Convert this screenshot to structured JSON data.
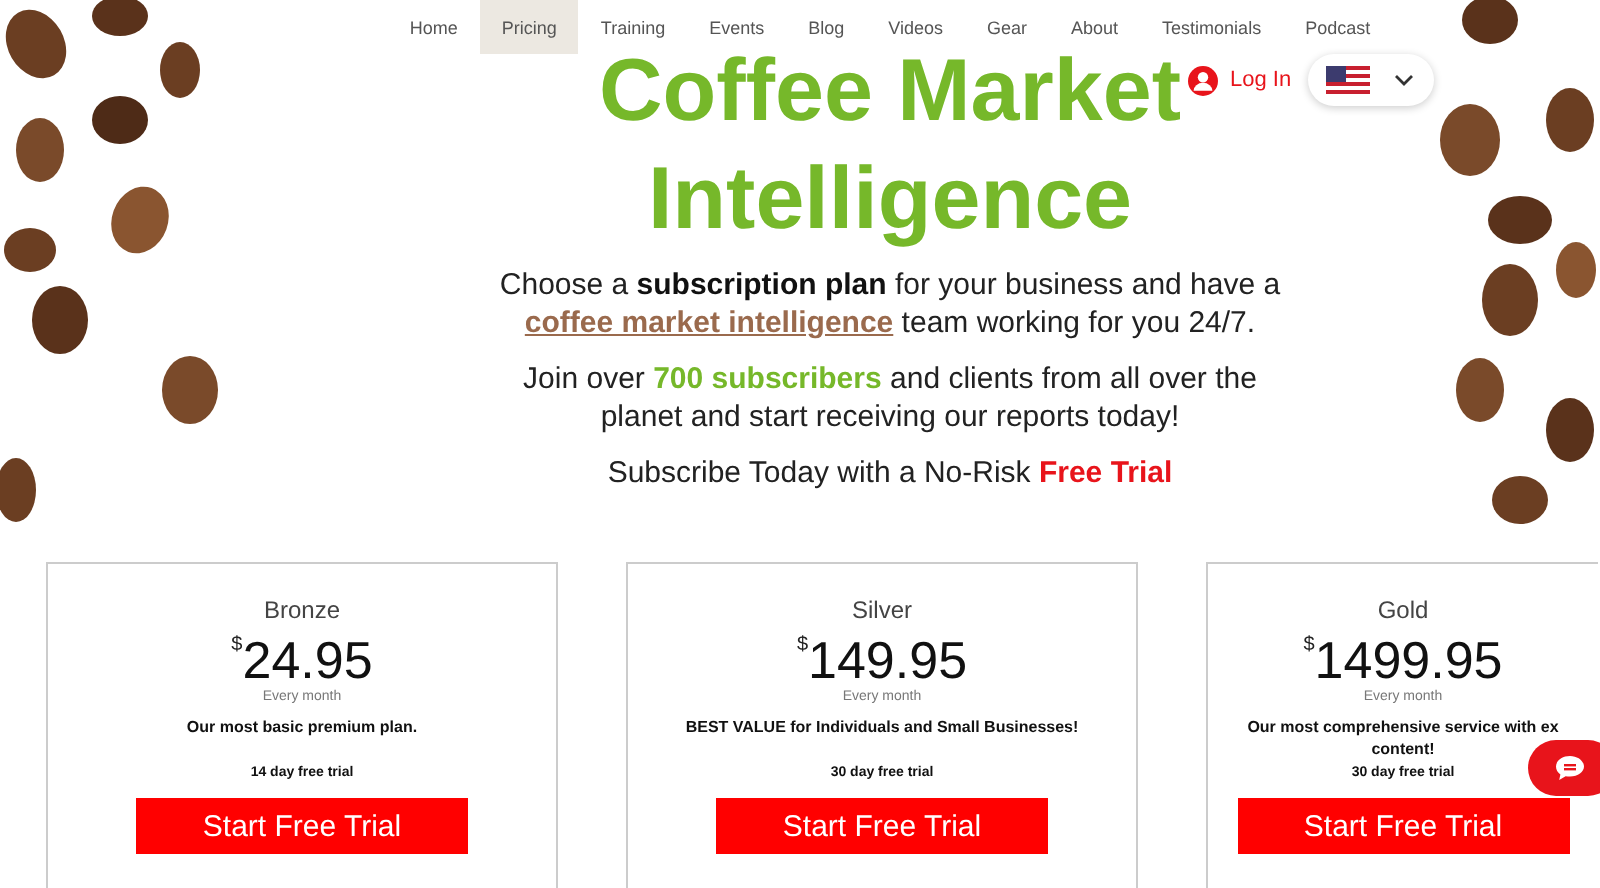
{
  "nav": [
    {
      "label": "Home",
      "selected": false
    },
    {
      "label": "Pricing",
      "selected": true
    },
    {
      "label": "Training",
      "selected": false
    },
    {
      "label": "Events",
      "selected": false
    },
    {
      "label": "Blog",
      "selected": false
    },
    {
      "label": "Videos",
      "selected": false
    },
    {
      "label": "Gear",
      "selected": false
    },
    {
      "label": "About",
      "selected": false
    },
    {
      "label": "Testimonials",
      "selected": false
    },
    {
      "label": "Podcast",
      "selected": false
    }
  ],
  "login": {
    "label": "Log In"
  },
  "hero": {
    "title_lines": [
      "Coffee Market",
      "Intelligence"
    ],
    "paragraphs": [
      [
        {
          "text": "Choose a ",
          "kind": "plain"
        },
        {
          "text": "subscription plan",
          "kind": "bold"
        },
        {
          "text": " for your business and have a ",
          "kind": "plain"
        },
        {
          "text": "coffee market intelligence",
          "kind": "link"
        },
        {
          "text": " team working for you 24/7.",
          "kind": "plain"
        }
      ],
      [
        {
          "text": "Join over ",
          "kind": "plain"
        },
        {
          "text": "700 subscribers",
          "kind": "green"
        },
        {
          "text": " and clients from all over the planet and start receiving our reports today!",
          "kind": "plain"
        }
      ],
      [
        {
          "text": "Subscribe Today with a No-Risk ",
          "kind": "plain"
        },
        {
          "text": "Free Trial",
          "kind": "red"
        }
      ]
    ]
  },
  "plans": [
    {
      "name": "Bronze",
      "currency": "$",
      "price": "24.95",
      "period": "Every month",
      "description": [
        "Our most basic premium plan."
      ],
      "trial": "14 day free trial",
      "button": "Start Free Trial"
    },
    {
      "name": "Silver",
      "currency": "$",
      "price": "149.95",
      "period": "Every month",
      "description": [
        "BEST VALUE for Individuals and Small Businesses!"
      ],
      "trial": "30 day free trial",
      "button": "Start Free Trial"
    },
    {
      "name": "Gold",
      "currency": "$",
      "price": "1499.95",
      "period": "Every month",
      "description": [
        "Our most comprehensive service with ex",
        "content!"
      ],
      "trial": "30 day free trial",
      "button": "Start Free Trial"
    }
  ]
}
